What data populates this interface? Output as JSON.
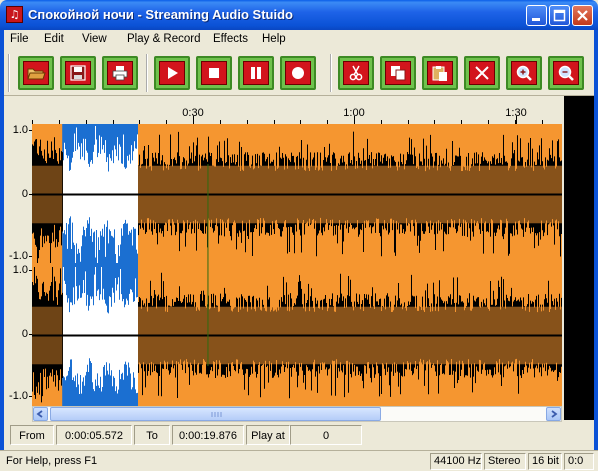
{
  "window": {
    "title": "Спокойной ночи - Streaming Audio Stuido",
    "app_icon_letter": "♫"
  },
  "menu": [
    "File",
    "Edit",
    "View",
    "Play & Record",
    "Effects",
    "Help"
  ],
  "toolbar": {
    "buttons": [
      "open-folder-icon",
      "save-icon",
      "print-icon",
      "play-icon",
      "stop-icon",
      "pause-icon",
      "record-icon",
      "cut-icon",
      "copy-icon",
      "paste-icon",
      "delete-icon",
      "zoom-in-icon",
      "zoom-out-icon"
    ]
  },
  "timeline": {
    "labels": [
      "0:30",
      "1:00",
      "1:30"
    ]
  },
  "yaxis": {
    "ch1": [
      "1.0",
      "0",
      "-1.0"
    ],
    "ch2": [
      "1.0",
      "0",
      "-1.0"
    ]
  },
  "waveform": {
    "colors": {
      "background": "#f59630",
      "wave": "#000000",
      "selection": "#1b6fd1",
      "selection_wave": "#ffffff"
    },
    "selection_fraction": [
      0.057,
      0.2
    ],
    "cursor_fraction": 0.332
  },
  "position": {
    "from_label": "From",
    "from_value": "0:00:05.572",
    "to_label": "To",
    "to_value": "0:00:19.876",
    "playat_label": "Play at",
    "playat_value": "0"
  },
  "status": {
    "help_text": "For Help, press F1",
    "sample_rate": "44100 Hz",
    "channels": "Stereo",
    "bits": "16 bit",
    "extra": "0:0"
  }
}
